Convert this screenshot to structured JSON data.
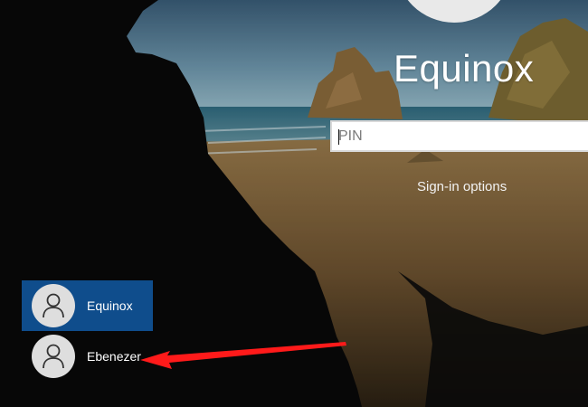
{
  "wallpaper": {
    "description_colors": {
      "sky": "#3f6f8f",
      "sea": "#3f7f92",
      "sand": "#8a6a3a",
      "cave": "#070707"
    }
  },
  "account": {
    "name": "Equinox",
    "avatar_icon": "person-icon"
  },
  "signin": {
    "pin_placeholder": "PIN",
    "pin_value": "",
    "options_label": "Sign-in options"
  },
  "users": [
    {
      "name": "Equinox",
      "selected": true,
      "icon": "person-icon"
    },
    {
      "name": "Ebenezer",
      "selected": false,
      "icon": "person-icon"
    }
  ],
  "annotation": {
    "arrow_color": "#ff1a1a",
    "points_to": "Ebenezer"
  },
  "colors": {
    "selected_tile": "#0f4d8c",
    "avatar_bg": "#dedede"
  }
}
